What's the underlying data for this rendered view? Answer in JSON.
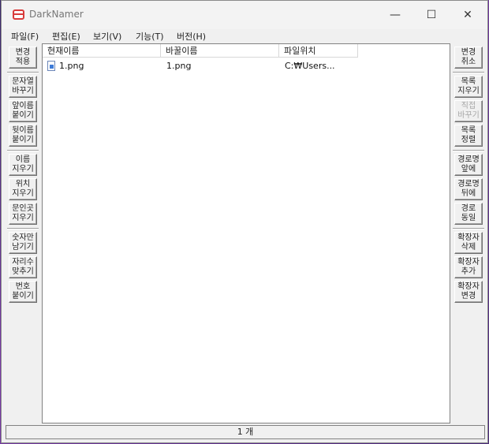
{
  "window": {
    "title": "DarkNamer"
  },
  "menu": [
    "파일(F)",
    "편집(E)",
    "보기(V)",
    "기능(T)",
    "버전(H)"
  ],
  "left_buttons": [
    {
      "label": "변경\n적용"
    },
    {
      "label": "문자열\n바꾸기"
    },
    {
      "label": "앞이름\n붙이기"
    },
    {
      "label": "뒷이름\n붙이기"
    },
    {
      "label": "이름\n지우기"
    },
    {
      "label": "위치\n지우기"
    },
    {
      "label": "문인곳\n지우기"
    },
    {
      "label": "숫자만\n남기기"
    },
    {
      "label": "자리수\n맞추기"
    },
    {
      "label": "번호\n붙이기"
    }
  ],
  "right_buttons": [
    {
      "label": "변경\n취소"
    },
    {
      "label": "목록\n지우기"
    },
    {
      "label": "직접\n바꾸기",
      "disabled": true
    },
    {
      "label": "목록\n정렬"
    },
    {
      "label": "경로명\n앞에"
    },
    {
      "label": "경로명\n뒤에"
    },
    {
      "label": "경로\n동일"
    },
    {
      "label": "확장자\n삭제"
    },
    {
      "label": "확장자\n추가"
    },
    {
      "label": "확장자\n변경"
    }
  ],
  "columns": [
    "현재이름",
    "바꿀이름",
    "파일위치"
  ],
  "rows": [
    {
      "current": "1.png",
      "new": "1.png",
      "location": "C:₩Users..."
    }
  ],
  "status": "1 개"
}
